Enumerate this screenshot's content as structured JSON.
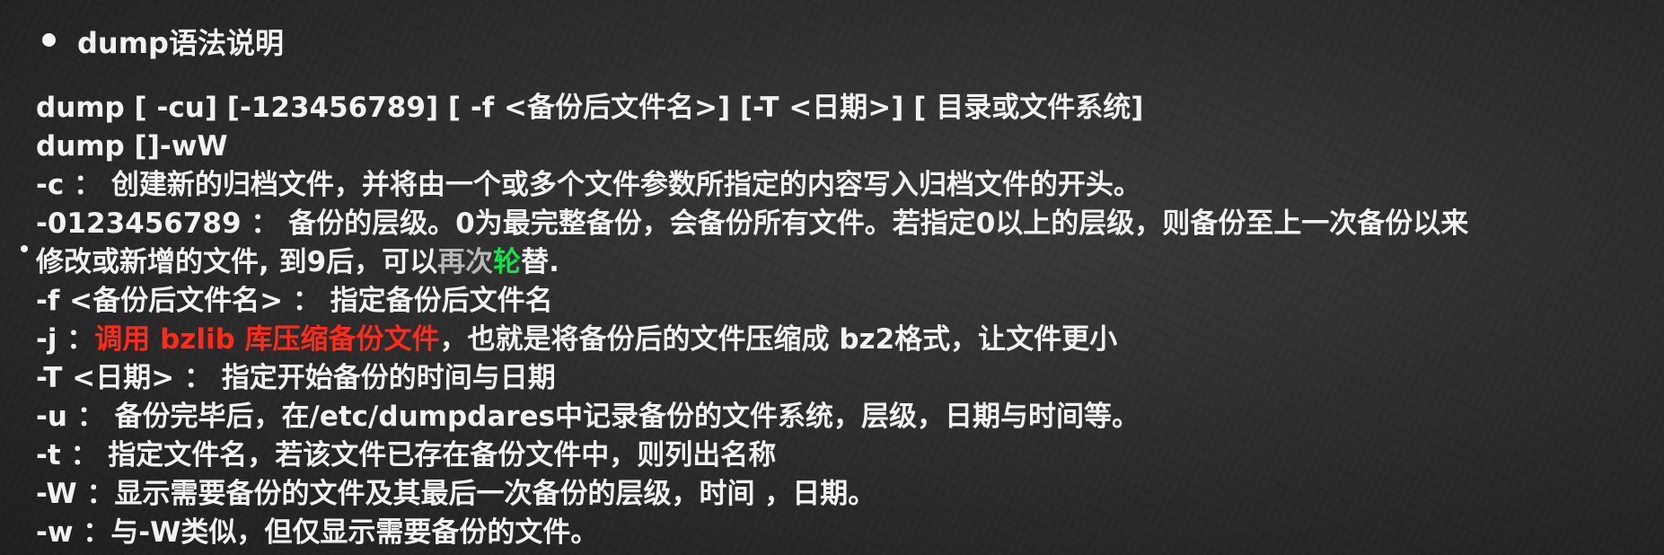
{
  "slide": {
    "title": "dump语法说明",
    "lines": [
      "dump  [ -cu]  [-123456789]  [ -f <备份后文件名>]  [-T <日期>]   [ 目录或文件系统]",
      "dump  []-wW",
      "-c ： 创建新的归档文件，并将由一个或多个文件参数所指定的内容写入归档文件的开头。",
      "-0123456789 ： 备份的层级。0为最完整备份，会备份所有文件。若指定0以上的层级，则备份至上一次备份以来",
      "-f <备份后文件名> ： 指定备份后文件名",
      "-T <日期> ： 指定开始备份的时间与日期",
      "-u ： 备份完毕后，在/etc/dumpdares中记录备份的文件系统，层级，日期与时间等。",
      "-t ： 指定文件名，若该文件已存在备份文件中，则列出名称",
      "-W ：显示需要备份的文件及其最后一次备份的层级，时间 ，日期。",
      "-w ：与-W类似，但仅显示需要备份的文件。"
    ],
    "modified_line": {
      "prefix": "修改或新增的文件, 到9后，可以",
      "grey": "再次",
      "green": "轮",
      "suffix": "替."
    },
    "j_line": {
      "prefix": "-j   ：",
      "red": "调用 bzlib 库压缩备份文件",
      "suffix": "，也就是将备份后的文件压缩成 bz2格式，让文件更小"
    }
  },
  "colors": {
    "background": "#2b2b2b",
    "text": "#f2f2f2",
    "emphasis_red": "#ff2a1a",
    "highlight_green": "#16e04a"
  }
}
